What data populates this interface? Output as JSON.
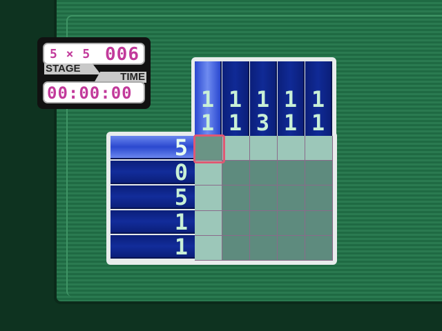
{
  "stage": {
    "grid_size": "5 × 5",
    "number": "006",
    "stage_label": "STAGE",
    "time_label": "TIME",
    "time": "00:00:00"
  },
  "puzzle": {
    "column_clues": [
      [
        "1",
        "1"
      ],
      [
        "1",
        "1"
      ],
      [
        "1",
        "3"
      ],
      [
        "1",
        "1"
      ],
      [
        "1",
        "1"
      ]
    ],
    "row_clues": [
      "5",
      "0",
      "5",
      "1",
      "1"
    ],
    "active_row": 0,
    "active_col": 0,
    "colors": {
      "clue_blue": "#102a96",
      "highlight": "#9cc7b9",
      "cell": "#5e8b7e",
      "cursor": "#e05873"
    }
  }
}
